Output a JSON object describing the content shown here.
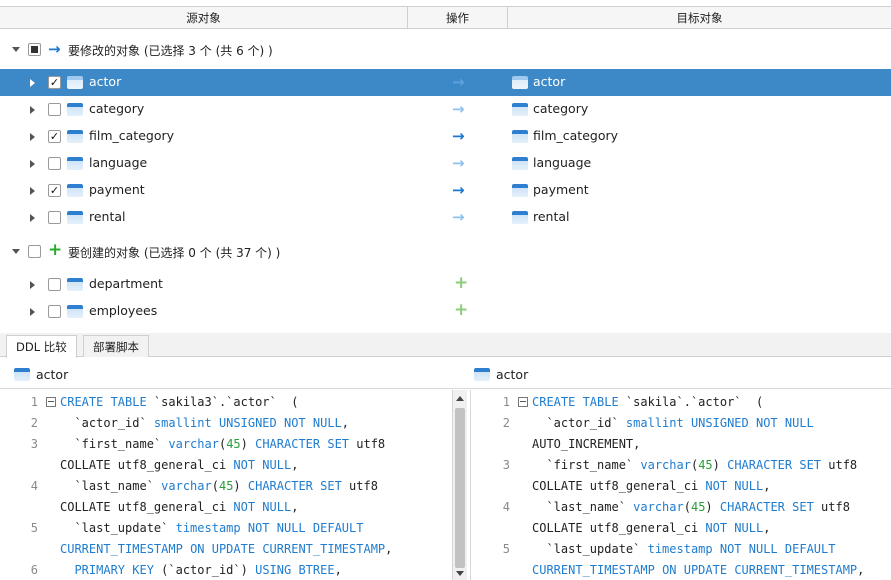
{
  "header": {
    "source": "源对象",
    "operation": "操作",
    "target": "目标对象"
  },
  "groups": {
    "modify": {
      "label": "要修改的对象 (已选择 3 个 (共 6 个) )"
    },
    "create": {
      "label": "要创建的对象 (已选择 0 个 (共 37 个) )"
    }
  },
  "modify_rows": [
    {
      "name": "actor",
      "checked": true,
      "target": "actor",
      "selected": true
    },
    {
      "name": "category",
      "checked": false,
      "target": "category"
    },
    {
      "name": "film_category",
      "checked": true,
      "target": "film_category"
    },
    {
      "name": "language",
      "checked": false,
      "target": "language"
    },
    {
      "name": "payment",
      "checked": true,
      "target": "payment"
    },
    {
      "name": "rental",
      "checked": false,
      "target": "rental"
    }
  ],
  "create_rows": [
    {
      "name": "department",
      "checked": false
    },
    {
      "name": "employees",
      "checked": false
    }
  ],
  "tabs": {
    "ddl": "DDL 比较",
    "deploy": "部署脚本"
  },
  "left_pane": {
    "title": "actor",
    "lines": [
      {
        "n": "1",
        "t": "CREATE TABLE `sakila3`.`actor`  ("
      },
      {
        "n": "2",
        "t": "  `actor_id` smallint UNSIGNED NOT NULL,"
      },
      {
        "n": "3",
        "t": "  `first_name` varchar(45) CHARACTER SET utf8"
      },
      {
        "n": "",
        "t": "COLLATE utf8_general_ci NOT NULL,"
      },
      {
        "n": "4",
        "t": "  `last_name` varchar(45) CHARACTER SET utf8"
      },
      {
        "n": "",
        "t": "COLLATE utf8_general_ci NOT NULL,"
      },
      {
        "n": "5",
        "t": "  `last_update` timestamp NOT NULL DEFAULT"
      },
      {
        "n": "",
        "t": "CURRENT_TIMESTAMP ON UPDATE CURRENT_TIMESTAMP,"
      },
      {
        "n": "6",
        "t": "  PRIMARY KEY (`actor_id`) USING BTREE,"
      }
    ]
  },
  "right_pane": {
    "title": "actor",
    "lines": [
      {
        "n": "1",
        "t": "CREATE TABLE `sakila`.`actor`  ("
      },
      {
        "n": "2",
        "t": "  `actor_id` smallint UNSIGNED NOT NULL"
      },
      {
        "n": "",
        "t": "AUTO_INCREMENT,"
      },
      {
        "n": "3",
        "t": "  `first_name` varchar(45) CHARACTER SET utf8"
      },
      {
        "n": "",
        "t": "COLLATE utf8_general_ci NOT NULL,"
      },
      {
        "n": "4",
        "t": "  `last_name` varchar(45) CHARACTER SET utf8"
      },
      {
        "n": "",
        "t": "COLLATE utf8_general_ci NOT NULL,"
      },
      {
        "n": "5",
        "t": "  `last_update` timestamp NOT NULL DEFAULT"
      },
      {
        "n": "",
        "t": "CURRENT_TIMESTAMP ON UPDATE CURRENT_TIMESTAMP,"
      }
    ]
  },
  "icons": {
    "arrow": "right-arrow-icon",
    "plus": "plus-icon",
    "table": "table-icon",
    "expand": "expand-triangle-icon"
  },
  "colors": {
    "selection": "#3d89c7",
    "keyword": "#1f7ccf",
    "number": "#2a9e3a"
  }
}
